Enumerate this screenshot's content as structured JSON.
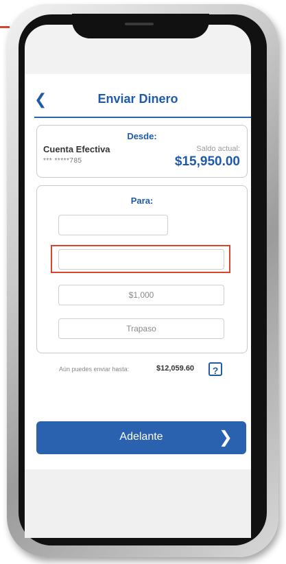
{
  "header": {
    "title": "Enviar Dinero",
    "back_icon": "chevron-left-icon"
  },
  "from": {
    "title": "Desde:",
    "account_name": "Cuenta Efectiva",
    "account_number": "*** *****785",
    "balance_label": "Saldo actual:",
    "balance": "$15,950.00"
  },
  "to": {
    "title": "Para:",
    "fields": [
      {
        "value": ""
      },
      {
        "value": ""
      },
      {
        "value": "$1,000"
      },
      {
        "value": "Trapaso"
      }
    ]
  },
  "limit": {
    "text": "Aún puedes enviar hasta:",
    "amount": "$12,059.60",
    "help_label": "?"
  },
  "actions": {
    "next_label": "Adelante",
    "next_icon": "chevron-right-icon"
  },
  "colors": {
    "accent": "#2b62b0",
    "highlight": "#d9442f"
  }
}
